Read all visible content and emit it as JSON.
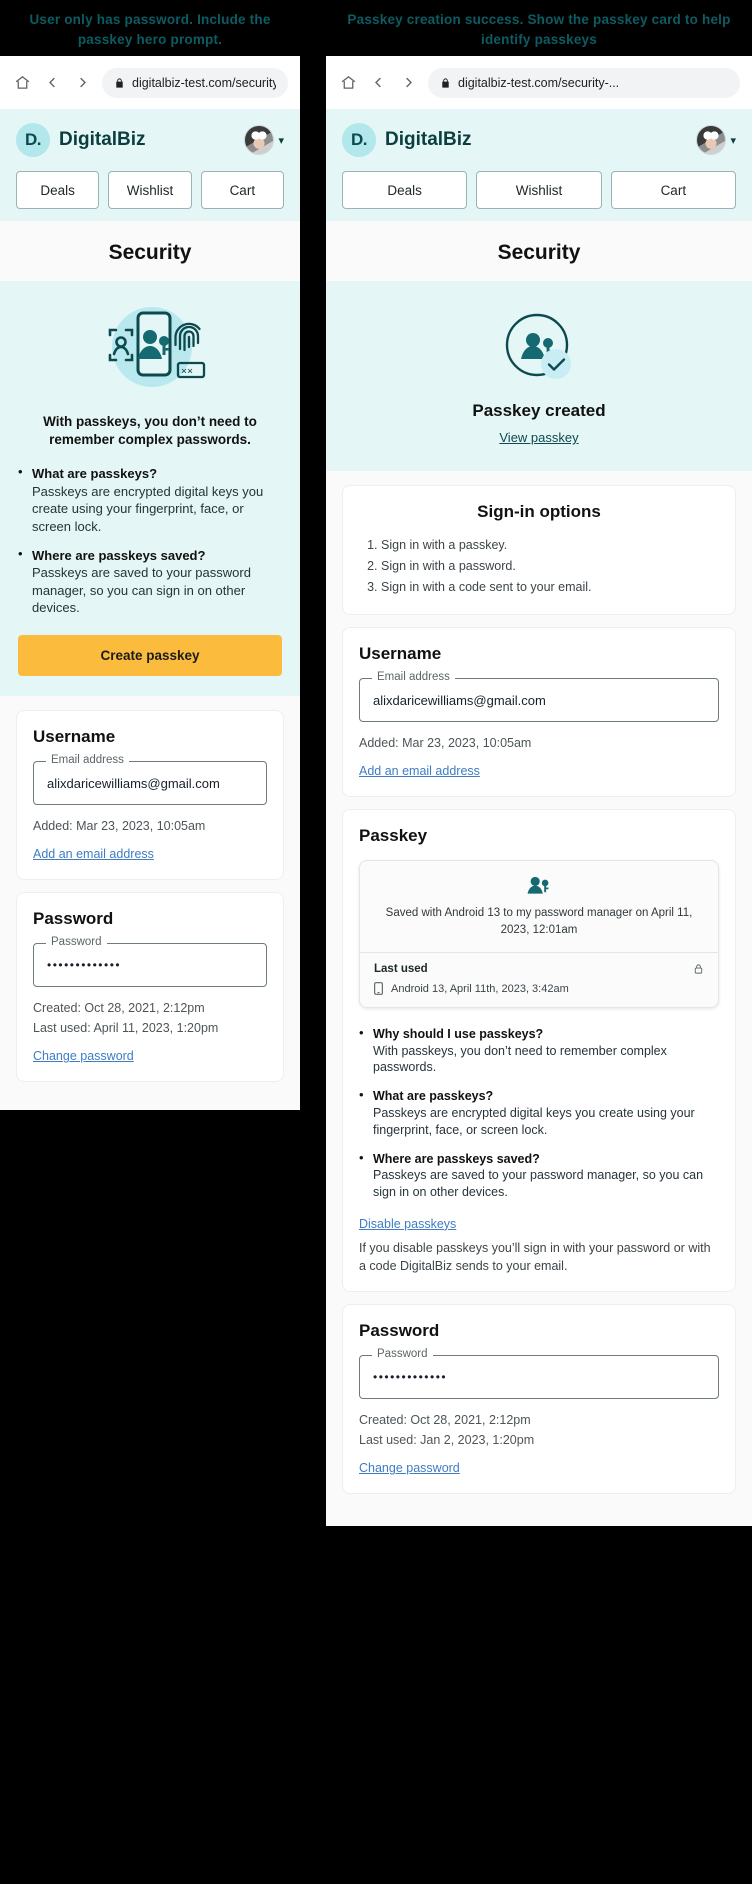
{
  "left": {
    "caption": "User only has password. Include the passkey hero prompt.",
    "browser": {
      "url": "digitalbiz-test.com/security-...",
      "home_icon": "home-icon",
      "back_icon": "chevron-left-icon",
      "forward_icon": "chevron-right-icon",
      "lock_icon": "lock-icon"
    },
    "brand": {
      "badge": "D.",
      "name": "DigitalBiz"
    },
    "nav_tabs": [
      "Deals",
      "Wishlist",
      "Cart"
    ],
    "page_title": "Security",
    "hero": {
      "lead": "With passkeys, you don’t need to remember complex passwords.",
      "bullets": [
        {
          "q": "What are passkeys?",
          "a": "Passkeys are encrypted digital keys you create using your fingerprint, face, or screen lock."
        },
        {
          "q": "Where are passkeys saved?",
          "a": "Passkeys are saved to your password manager, so you can sign in on other devices."
        }
      ],
      "cta": "Create passkey"
    },
    "username_card": {
      "title": "Username",
      "field_label": "Email address",
      "field_value": "alixdaricewilliams@gmail.com",
      "meta": "Added: Mar 23, 2023, 10:05am",
      "link": "Add an email address"
    },
    "password_card": {
      "title": "Password",
      "field_label": "Password",
      "field_value": "•••••••••••••",
      "meta_created": "Created: Oct 28, 2021, 2:12pm",
      "meta_used": "Last used: April 11, 2023, 1:20pm",
      "link": "Change password"
    }
  },
  "right": {
    "caption": "Passkey creation success. Show the passkey card to help identify passkeys",
    "browser": {
      "url": "digitalbiz-test.com/security-...",
      "home_icon": "home-icon",
      "back_icon": "chevron-left-icon",
      "forward_icon": "chevron-right-icon",
      "lock_icon": "lock-icon"
    },
    "brand": {
      "badge": "D.",
      "name": "DigitalBiz"
    },
    "nav_tabs": [
      "Deals",
      "Wishlist",
      "Cart"
    ],
    "page_title": "Security",
    "success": {
      "title": "Passkey created",
      "link": "View passkey"
    },
    "signin_card": {
      "title": "Sign-in options",
      "options": [
        "Sign in with a passkey.",
        "Sign in with a password.",
        "Sign in with a code sent to your email."
      ]
    },
    "username_card": {
      "title": "Username",
      "field_label": "Email address",
      "field_value": "alixdaricewilliams@gmail.com",
      "meta": "Added: Mar 23, 2023, 10:05am",
      "link": "Add an email address"
    },
    "passkey_card": {
      "title": "Passkey",
      "detail_desc": "Saved with Android 13 to my password manager on April 11, 2023, 12:01am",
      "last_used_label": "Last used",
      "last_used_value": "Android 13, April 11th, 2023, 3:42am",
      "bullets": [
        {
          "q": "Why should I use passkeys?",
          "a": "With passkeys, you don’t need to remember complex passwords."
        },
        {
          "q": "What are passkeys?",
          "a": "Passkeys are encrypted digital keys you create using your fingerprint, face, or screen lock."
        },
        {
          "q": "Where are passkeys saved?",
          "a": "Passkeys are saved to your password manager, so you can sign in on other devices."
        }
      ],
      "disable_link": "Disable passkeys",
      "disable_note": "If you disable passkeys you’ll sign in with your password or with a code DigitalBiz sends to your email."
    },
    "password_card": {
      "title": "Password",
      "field_label": "Password",
      "field_value": "•••••••••••••",
      "meta_created": "Created: Oct 28, 2021, 2:12pm",
      "meta_used": "Last used: Jan 2, 2023, 1:20pm",
      "link": "Change password"
    }
  },
  "colors": {
    "accent_teal": "#0c4a4f",
    "hero_bg": "#e4f6f5",
    "cta_amber": "#fbbc3d",
    "link_blue": "#3f7cc4"
  }
}
